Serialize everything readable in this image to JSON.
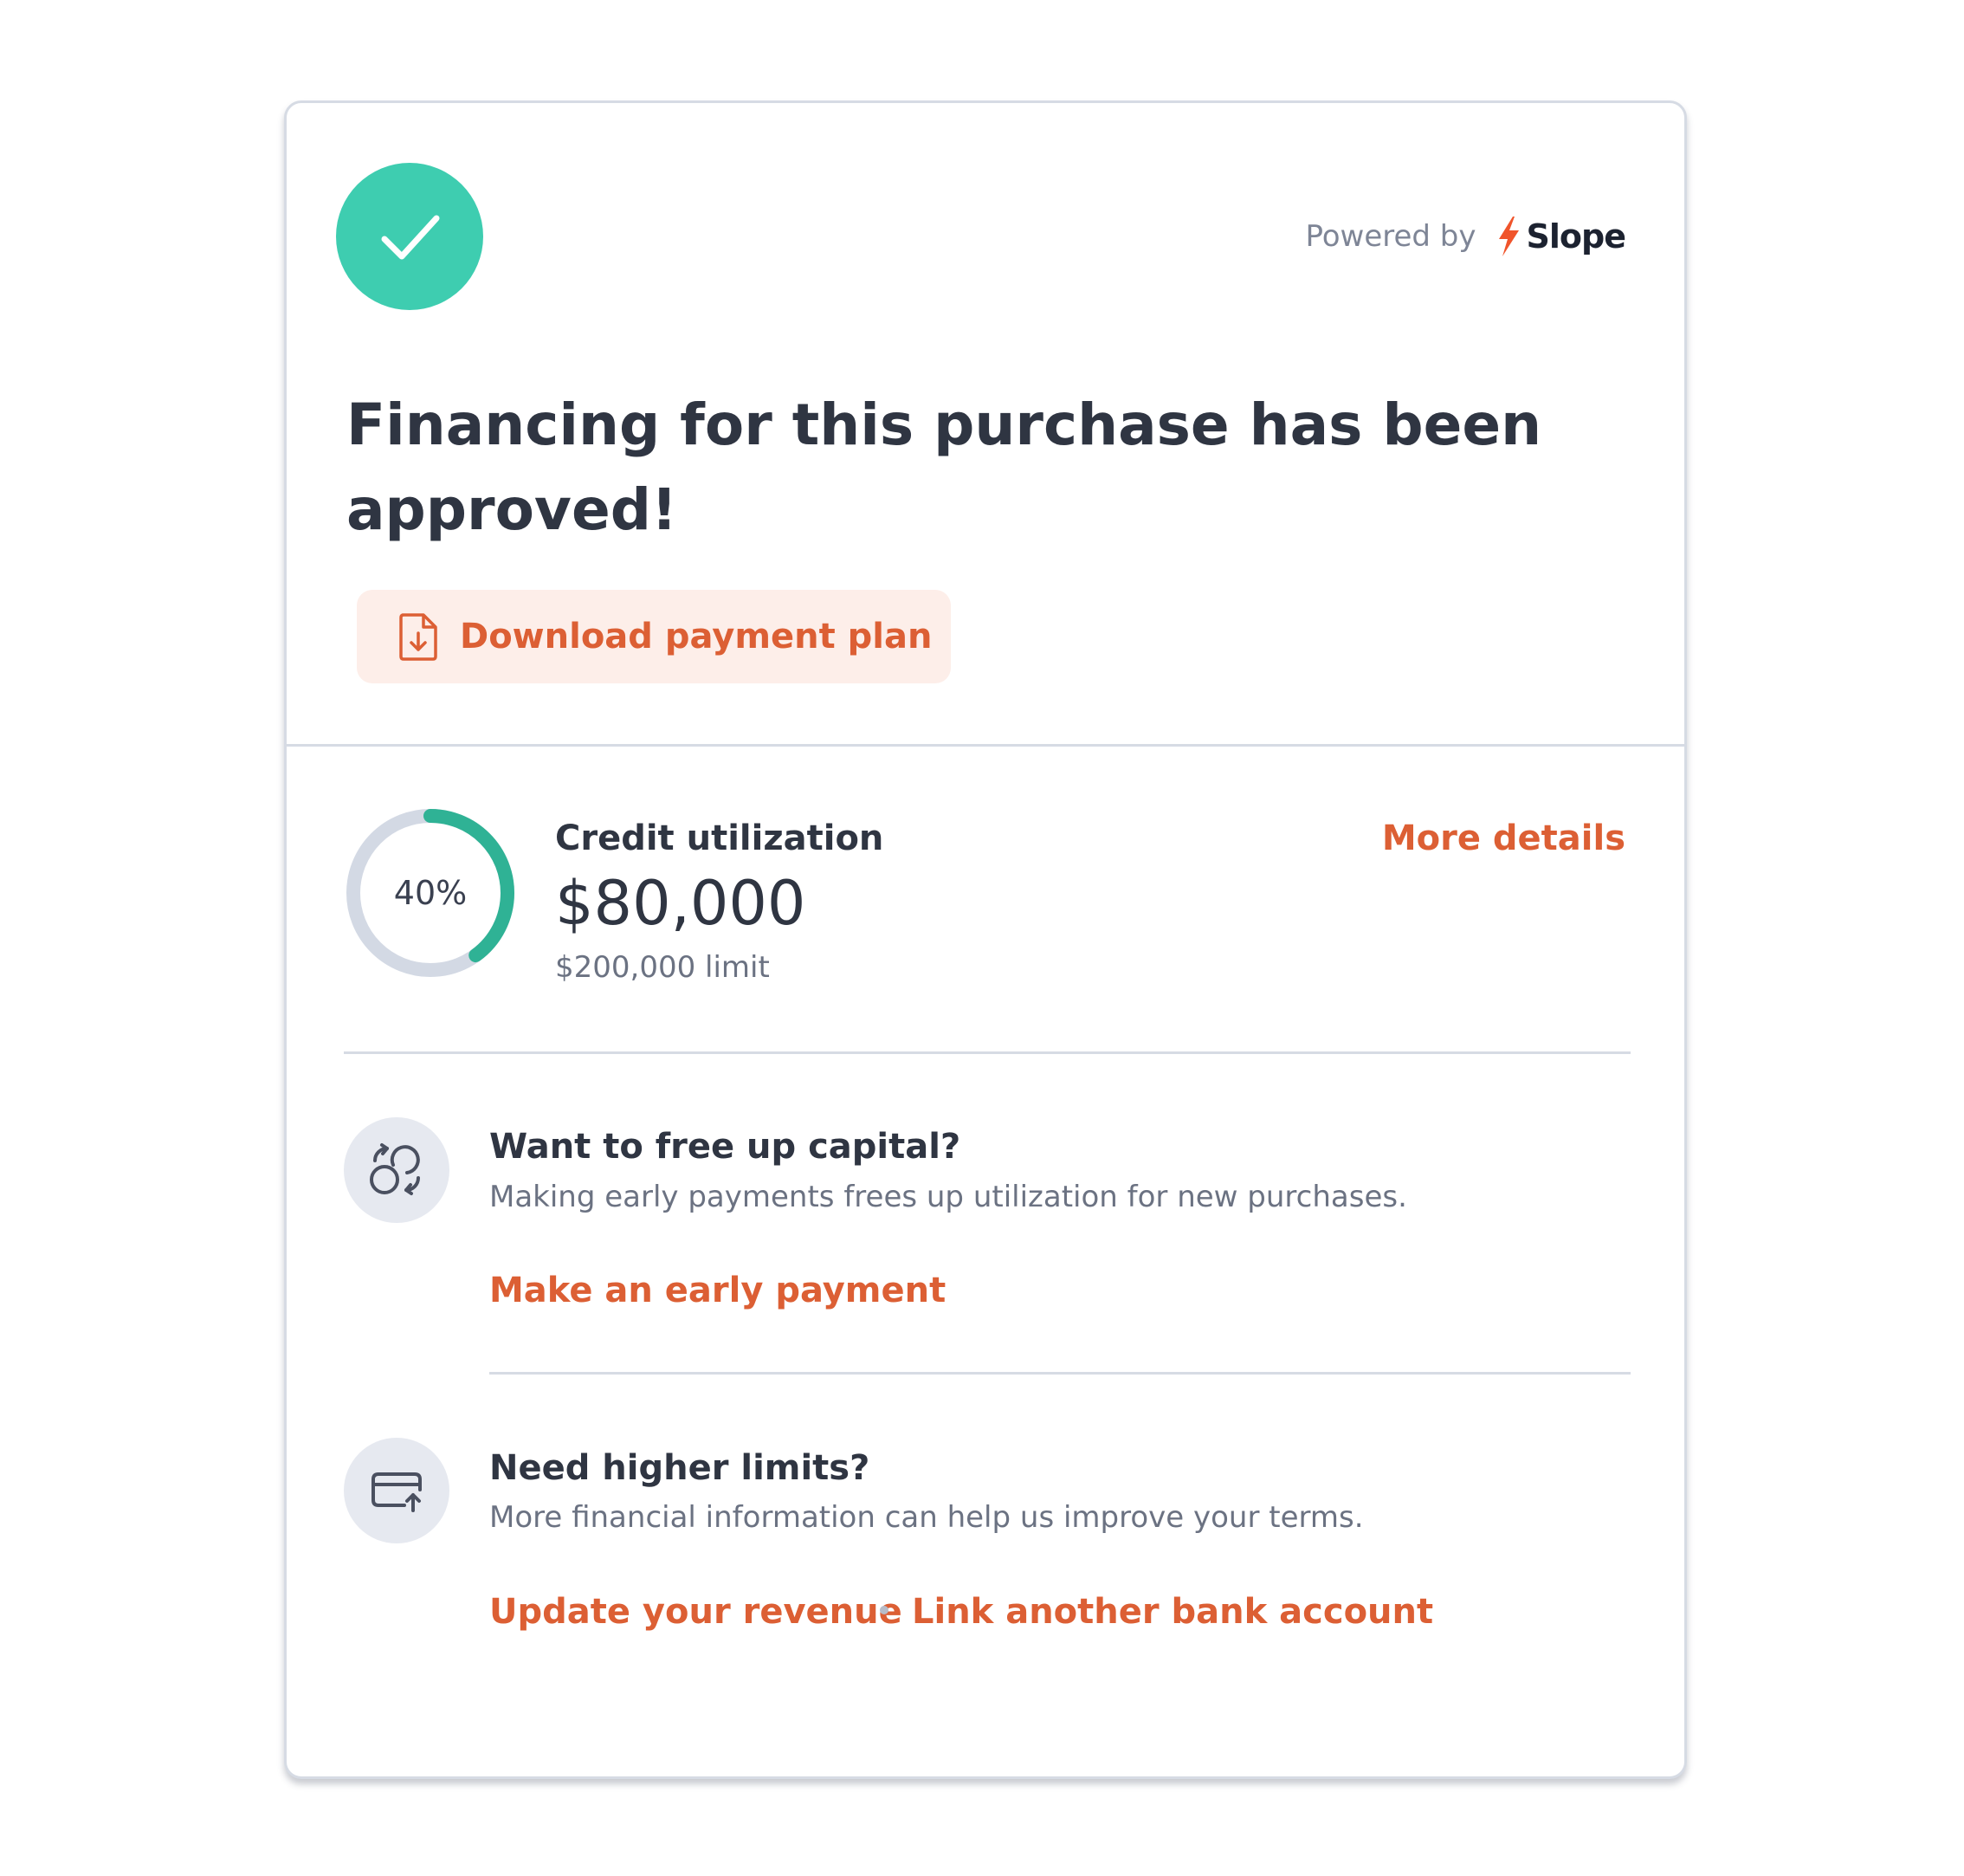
{
  "header": {
    "success_icon": "checkmark-icon",
    "powered_by_label": "Powered by",
    "brand_name": "Slope",
    "brand_icon": "lightning-bolt-icon"
  },
  "title": "Financing for this purchase has been approved!",
  "download": {
    "icon": "document-download-icon",
    "label": "Download payment plan"
  },
  "credit": {
    "utilization_percent": 40,
    "percent_label": "40%",
    "label": "Credit utilization",
    "amount": "$80,000",
    "limit": "$200,000 limit",
    "more_details_label": "More details"
  },
  "free_capital": {
    "icon": "refresh-coins-icon",
    "title": "Want to free up capital?",
    "description": "Making early payments frees up utilization for new purchases.",
    "action_label": "Make an early payment"
  },
  "higher_limits": {
    "icon": "card-upload-icon",
    "title": "Need higher limits?",
    "description": "More financial information can help us improve your terms.",
    "action_revenue_label": "Update your revenue",
    "action_bank_label": "Link another bank account"
  },
  "colors": {
    "success": "#3ecdb0",
    "accent": "#dc5f34",
    "accent_bg": "#fdeee9",
    "gauge_fill": "#2fb295",
    "gauge_track": "#d3d9e4",
    "icon_bg": "#e6e9f0"
  }
}
